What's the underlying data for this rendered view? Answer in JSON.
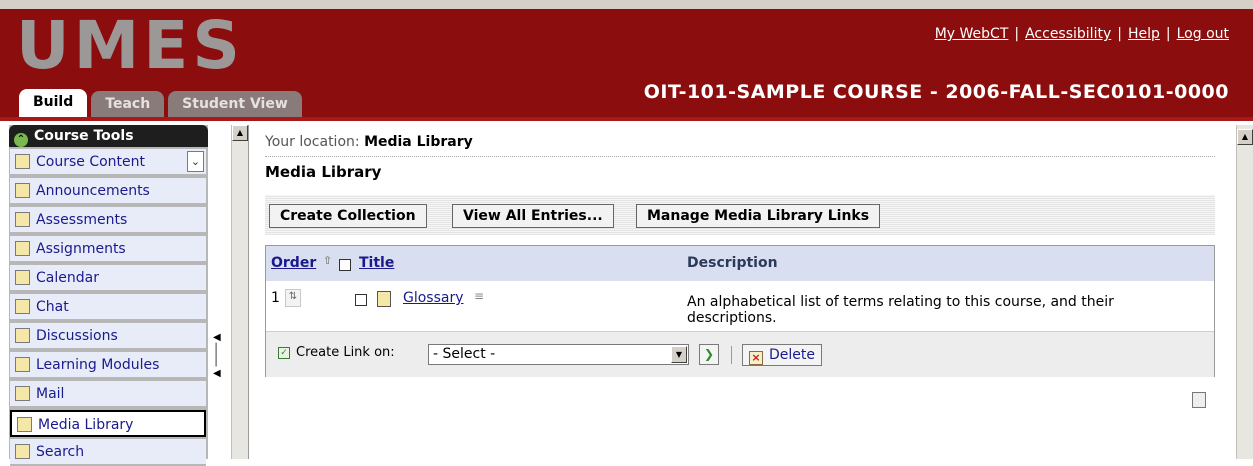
{
  "header": {
    "logo": "UMES",
    "links": [
      "My WebCT",
      "Accessibility",
      "Help",
      "Log out"
    ],
    "link_separator": "|",
    "tabs": [
      {
        "label": "Build",
        "active": true
      },
      {
        "label": "Teach",
        "active": false
      },
      {
        "label": "Student View",
        "active": false
      }
    ],
    "course_title": "OIT-101-SAMPLE COURSE - 2006-FALL-SEC0101-0000"
  },
  "sidebar": {
    "title": "Course Tools",
    "items": [
      {
        "label": "Course Content",
        "icon": "home-icon"
      },
      {
        "label": "Announcements",
        "icon": "megaphone-icon"
      },
      {
        "label": "Assessments",
        "icon": "assessment-icon"
      },
      {
        "label": "Assignments",
        "icon": "assignment-icon"
      },
      {
        "label": "Calendar",
        "icon": "calendar-icon"
      },
      {
        "label": "Chat",
        "icon": "chat-icon"
      },
      {
        "label": "Discussions",
        "icon": "pin-icon"
      },
      {
        "label": "Learning Modules",
        "icon": "module-icon"
      },
      {
        "label": "Mail",
        "icon": "mail-icon"
      },
      {
        "label": "Media Library",
        "icon": "media-library-icon",
        "selected": true
      },
      {
        "label": "Search",
        "icon": "search-icon"
      }
    ]
  },
  "main": {
    "location_prefix": "Your location:",
    "location": "Media Library",
    "title": "Media Library",
    "buttons": [
      "Create Collection",
      "View All Entries...",
      "Manage Media Library Links"
    ],
    "table": {
      "columns": [
        "Order",
        "Title",
        "Description"
      ],
      "rows": [
        {
          "order": "1",
          "title": "Glossary",
          "description_line1": "An alphabetical list of terms relating to this course, and their",
          "description_line2": "descriptions."
        }
      ]
    },
    "actions": {
      "create_link_label": "Create Link on:",
      "select_value": "- Select -",
      "delete_label": "Delete"
    }
  },
  "colors": {
    "header_bg": "#8b0d0d",
    "menu_bg": "#e8ecf9",
    "table_header_bg": "#d9dff0",
    "link": "#1a1a8c"
  }
}
